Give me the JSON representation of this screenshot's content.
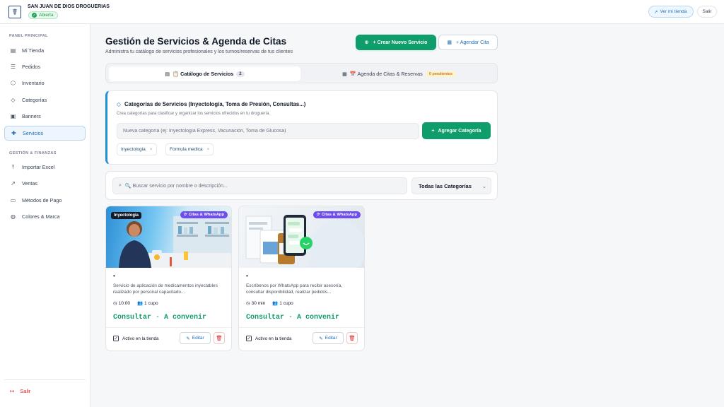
{
  "header": {
    "store_name": "SAN JUAN DE DIOS DROGUERIAS",
    "status": "Abierta",
    "view_store_label": "Ver mi tienda",
    "logout_label": "Salir"
  },
  "sidebar": {
    "section_main": "PANEL PRINCIPAL",
    "section_finance": "GESTIÓN & FINANZAS",
    "main_items": [
      {
        "label": "Mi Tienda",
        "icon": "store-icon"
      },
      {
        "label": "Pedidos",
        "icon": "orders-icon"
      },
      {
        "label": "Inventario",
        "icon": "box-icon"
      },
      {
        "label": "Categorías",
        "icon": "tag-icon"
      },
      {
        "label": "Banners",
        "icon": "image-icon"
      },
      {
        "label": "Servicios",
        "icon": "services-icon",
        "active": true
      }
    ],
    "finance_items": [
      {
        "label": "Importar Excel",
        "icon": "upload-icon"
      },
      {
        "label": "Ventas",
        "icon": "chart-icon"
      },
      {
        "label": "Métodos de Pago",
        "icon": "card-icon"
      },
      {
        "label": "Colores & Marca",
        "icon": "palette-icon"
      }
    ],
    "logout_label": "Salir"
  },
  "main": {
    "title": "Gestión de Servicios & Agenda de Citas",
    "subtitle": "Administra tu catálogo de servicios profesionales y los turnos/reservas de tus clientes",
    "create_service_label": "+ Crear Nuevo Servicio",
    "schedule_label": "+ Agendar Cita",
    "tabs": [
      {
        "label": "📋 Catálogo de Servicios",
        "count": "2"
      },
      {
        "label": "📅 Agenda de Citas & Reservas",
        "badge": "0 pendientes"
      }
    ],
    "categories": {
      "title": "Categorías de Servicios (Inyectología, Toma de Presión, Consultas...)",
      "description": "Crea categorías para clasificar y organizar los servicios ofrecidos en tu droguería.",
      "input_placeholder": "Nueva categoría (ej: Inyectología Express, Vacunación, Toma de Glucosa)",
      "add_label": "Agregar Categoría",
      "chips": [
        "Inyectologia",
        "Formula medica"
      ]
    },
    "search": {
      "placeholder": "🔍 Buscar servicio por nombre o descripción...",
      "category_filter": "Todas las Categorías"
    },
    "cards": [
      {
        "tag": "Inyectologia",
        "badge": "Citas & WhatsApp",
        "name": "•",
        "description": "Servicio de aplicación de medicamentos inyectables realizado por personal capacitado...",
        "duration": "10:00",
        "capacity": "1 cupo",
        "price": "Consultar · A convenir",
        "active_label": "Activo en la tienda",
        "edit_label": "Editar"
      },
      {
        "tag": "",
        "badge": "Citas & WhatsApp",
        "name": "•",
        "description": "Escríbenos por WhatsApp para recibir asesoría, consultar disponibilidad, realizar pedidos...",
        "duration": "30 min",
        "capacity": "1 cupo",
        "price": "Consultar · A convenir",
        "active_label": "Activo en la tienda",
        "edit_label": "Editar"
      }
    ]
  }
}
